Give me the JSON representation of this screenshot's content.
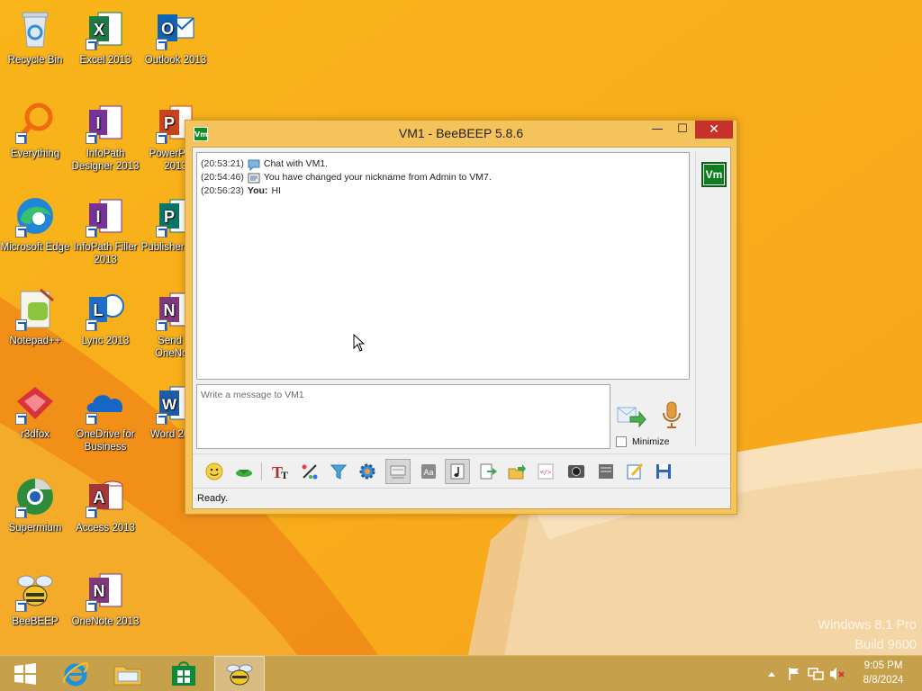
{
  "desktop": {
    "icons": [
      {
        "label": "Recycle Bin",
        "icon": "recycle-bin-icon"
      },
      {
        "label": "Excel 2013",
        "icon": "excel-icon"
      },
      {
        "label": "Outlook 2013",
        "icon": "outlook-icon"
      },
      {
        "label": "Everything",
        "icon": "everything-search-icon"
      },
      {
        "label": "InfoPath Designer 2013",
        "icon": "infopath-designer-icon"
      },
      {
        "label": "PowerPoint 2013",
        "icon": "powerpoint-icon"
      },
      {
        "label": "Microsoft Edge",
        "icon": "edge-icon"
      },
      {
        "label": "InfoPath Filler 2013",
        "icon": "infopath-filler-icon"
      },
      {
        "label": "Publisher 2013",
        "icon": "publisher-icon"
      },
      {
        "label": "Notepad++",
        "icon": "notepadpp-icon"
      },
      {
        "label": "Lync 2013",
        "icon": "lync-icon"
      },
      {
        "label": "Send to OneNote",
        "icon": "send-to-onenote-icon"
      },
      {
        "label": "r3dfox",
        "icon": "r3dfox-icon"
      },
      {
        "label": "OneDrive for Business",
        "icon": "onedrive-icon"
      },
      {
        "label": "Word 2013",
        "icon": "word-icon"
      },
      {
        "label": "Supermium",
        "icon": "supermium-icon"
      },
      {
        "label": "Access 2013",
        "icon": "access-icon"
      },
      {
        "label": "BeeBEEP",
        "icon": "beebeep-icon"
      },
      {
        "label": "OneNote 2013",
        "icon": "onenote-icon"
      }
    ],
    "watermark": {
      "line1": "Windows 8.1 Pro",
      "line2": "Build 9600"
    }
  },
  "window": {
    "title": "VM1 - BeeBEEP 5.8.6",
    "app_icon_text": "Vm",
    "buttons": {
      "minimize": "—",
      "maximize": "☐",
      "close": "✕"
    },
    "chat": [
      {
        "time": "(20:53:21)",
        "icon": "chat-bubble-icon",
        "who": "",
        "text": "Chat with VM1."
      },
      {
        "time": "(20:54:46)",
        "icon": "system-message-icon",
        "who": "",
        "text": "You have changed your nickname from Admin to VM7."
      },
      {
        "time": "(20:56:23)",
        "icon": "",
        "who": "You:",
        "text": "HI"
      }
    ],
    "avatar_text": "Vm",
    "input_placeholder": "Write a message to VM1",
    "minimize_label": "Minimize",
    "status": "Ready.",
    "toolbar": [
      {
        "name": "emoticon-icon",
        "pressed": false
      },
      {
        "name": "collapse-arrow-icon",
        "pressed": false
      },
      {
        "name": "font-icon",
        "pressed": false
      },
      {
        "name": "font-color-icon",
        "pressed": false
      },
      {
        "name": "filter-icon",
        "pressed": false
      },
      {
        "name": "settings-gear-icon",
        "pressed": false
      },
      {
        "name": "compact-view-icon",
        "pressed": true
      },
      {
        "name": "show-names-icon",
        "pressed": false
      },
      {
        "name": "sound-note-icon",
        "pressed": true
      },
      {
        "name": "export-icon",
        "pressed": false
      },
      {
        "name": "send-file-icon",
        "pressed": false
      },
      {
        "name": "html-code-icon",
        "pressed": false
      },
      {
        "name": "screenshot-icon",
        "pressed": false
      },
      {
        "name": "clear-history-icon",
        "pressed": false
      },
      {
        "name": "edit-notes-icon",
        "pressed": false
      },
      {
        "name": "save-chat-icon",
        "pressed": false
      }
    ]
  },
  "taskbar": {
    "items": [
      "start-icon",
      "internet-explorer-icon",
      "file-explorer-icon",
      "store-icon",
      "beebeep-taskbar-icon"
    ],
    "time": "9:05 PM",
    "date": "8/8/2024"
  },
  "colors": {
    "wallpaper": "#f7b21e",
    "window_frame": "#f5c35b",
    "close_button": "#c7312b",
    "taskbar": "#c7a04b"
  }
}
